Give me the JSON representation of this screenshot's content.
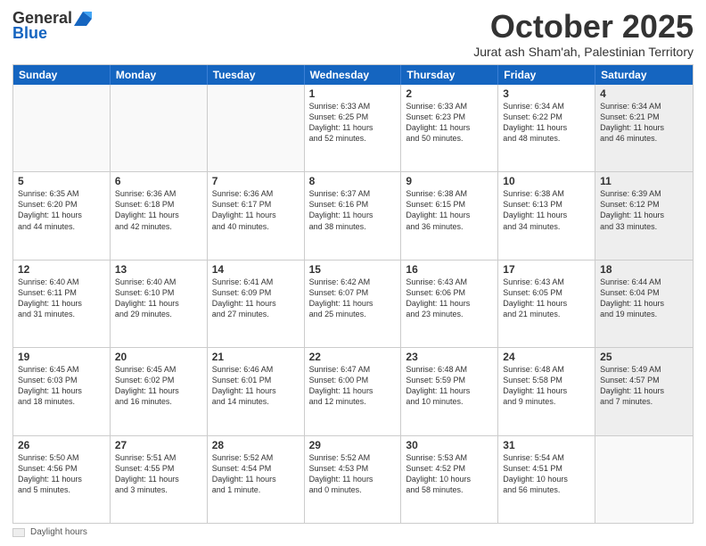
{
  "logo": {
    "general": "General",
    "blue": "Blue"
  },
  "title": "October 2025",
  "subtitle": "Jurat ash Sham'ah, Palestinian Territory",
  "days": [
    "Sunday",
    "Monday",
    "Tuesday",
    "Wednesday",
    "Thursday",
    "Friday",
    "Saturday"
  ],
  "weeks": [
    [
      {
        "day": "",
        "info": "",
        "shaded": false,
        "empty": true
      },
      {
        "day": "",
        "info": "",
        "shaded": false,
        "empty": true
      },
      {
        "day": "",
        "info": "",
        "shaded": false,
        "empty": true
      },
      {
        "day": "1",
        "info": "Sunrise: 6:33 AM\nSunset: 6:25 PM\nDaylight: 11 hours\nand 52 minutes.",
        "shaded": false,
        "empty": false
      },
      {
        "day": "2",
        "info": "Sunrise: 6:33 AM\nSunset: 6:23 PM\nDaylight: 11 hours\nand 50 minutes.",
        "shaded": false,
        "empty": false
      },
      {
        "day": "3",
        "info": "Sunrise: 6:34 AM\nSunset: 6:22 PM\nDaylight: 11 hours\nand 48 minutes.",
        "shaded": false,
        "empty": false
      },
      {
        "day": "4",
        "info": "Sunrise: 6:34 AM\nSunset: 6:21 PM\nDaylight: 11 hours\nand 46 minutes.",
        "shaded": true,
        "empty": false
      }
    ],
    [
      {
        "day": "5",
        "info": "Sunrise: 6:35 AM\nSunset: 6:20 PM\nDaylight: 11 hours\nand 44 minutes.",
        "shaded": false,
        "empty": false
      },
      {
        "day": "6",
        "info": "Sunrise: 6:36 AM\nSunset: 6:18 PM\nDaylight: 11 hours\nand 42 minutes.",
        "shaded": false,
        "empty": false
      },
      {
        "day": "7",
        "info": "Sunrise: 6:36 AM\nSunset: 6:17 PM\nDaylight: 11 hours\nand 40 minutes.",
        "shaded": false,
        "empty": false
      },
      {
        "day": "8",
        "info": "Sunrise: 6:37 AM\nSunset: 6:16 PM\nDaylight: 11 hours\nand 38 minutes.",
        "shaded": false,
        "empty": false
      },
      {
        "day": "9",
        "info": "Sunrise: 6:38 AM\nSunset: 6:15 PM\nDaylight: 11 hours\nand 36 minutes.",
        "shaded": false,
        "empty": false
      },
      {
        "day": "10",
        "info": "Sunrise: 6:38 AM\nSunset: 6:13 PM\nDaylight: 11 hours\nand 34 minutes.",
        "shaded": false,
        "empty": false
      },
      {
        "day": "11",
        "info": "Sunrise: 6:39 AM\nSunset: 6:12 PM\nDaylight: 11 hours\nand 33 minutes.",
        "shaded": true,
        "empty": false
      }
    ],
    [
      {
        "day": "12",
        "info": "Sunrise: 6:40 AM\nSunset: 6:11 PM\nDaylight: 11 hours\nand 31 minutes.",
        "shaded": false,
        "empty": false
      },
      {
        "day": "13",
        "info": "Sunrise: 6:40 AM\nSunset: 6:10 PM\nDaylight: 11 hours\nand 29 minutes.",
        "shaded": false,
        "empty": false
      },
      {
        "day": "14",
        "info": "Sunrise: 6:41 AM\nSunset: 6:09 PM\nDaylight: 11 hours\nand 27 minutes.",
        "shaded": false,
        "empty": false
      },
      {
        "day": "15",
        "info": "Sunrise: 6:42 AM\nSunset: 6:07 PM\nDaylight: 11 hours\nand 25 minutes.",
        "shaded": false,
        "empty": false
      },
      {
        "day": "16",
        "info": "Sunrise: 6:43 AM\nSunset: 6:06 PM\nDaylight: 11 hours\nand 23 minutes.",
        "shaded": false,
        "empty": false
      },
      {
        "day": "17",
        "info": "Sunrise: 6:43 AM\nSunset: 6:05 PM\nDaylight: 11 hours\nand 21 minutes.",
        "shaded": false,
        "empty": false
      },
      {
        "day": "18",
        "info": "Sunrise: 6:44 AM\nSunset: 6:04 PM\nDaylight: 11 hours\nand 19 minutes.",
        "shaded": true,
        "empty": false
      }
    ],
    [
      {
        "day": "19",
        "info": "Sunrise: 6:45 AM\nSunset: 6:03 PM\nDaylight: 11 hours\nand 18 minutes.",
        "shaded": false,
        "empty": false
      },
      {
        "day": "20",
        "info": "Sunrise: 6:45 AM\nSunset: 6:02 PM\nDaylight: 11 hours\nand 16 minutes.",
        "shaded": false,
        "empty": false
      },
      {
        "day": "21",
        "info": "Sunrise: 6:46 AM\nSunset: 6:01 PM\nDaylight: 11 hours\nand 14 minutes.",
        "shaded": false,
        "empty": false
      },
      {
        "day": "22",
        "info": "Sunrise: 6:47 AM\nSunset: 6:00 PM\nDaylight: 11 hours\nand 12 minutes.",
        "shaded": false,
        "empty": false
      },
      {
        "day": "23",
        "info": "Sunrise: 6:48 AM\nSunset: 5:59 PM\nDaylight: 11 hours\nand 10 minutes.",
        "shaded": false,
        "empty": false
      },
      {
        "day": "24",
        "info": "Sunrise: 6:48 AM\nSunset: 5:58 PM\nDaylight: 11 hours\nand 9 minutes.",
        "shaded": false,
        "empty": false
      },
      {
        "day": "25",
        "info": "Sunrise: 5:49 AM\nSunset: 4:57 PM\nDaylight: 11 hours\nand 7 minutes.",
        "shaded": true,
        "empty": false
      }
    ],
    [
      {
        "day": "26",
        "info": "Sunrise: 5:50 AM\nSunset: 4:56 PM\nDaylight: 11 hours\nand 5 minutes.",
        "shaded": false,
        "empty": false
      },
      {
        "day": "27",
        "info": "Sunrise: 5:51 AM\nSunset: 4:55 PM\nDaylight: 11 hours\nand 3 minutes.",
        "shaded": false,
        "empty": false
      },
      {
        "day": "28",
        "info": "Sunrise: 5:52 AM\nSunset: 4:54 PM\nDaylight: 11 hours\nand 1 minute.",
        "shaded": false,
        "empty": false
      },
      {
        "day": "29",
        "info": "Sunrise: 5:52 AM\nSunset: 4:53 PM\nDaylight: 11 hours\nand 0 minutes.",
        "shaded": false,
        "empty": false
      },
      {
        "day": "30",
        "info": "Sunrise: 5:53 AM\nSunset: 4:52 PM\nDaylight: 10 hours\nand 58 minutes.",
        "shaded": false,
        "empty": false
      },
      {
        "day": "31",
        "info": "Sunrise: 5:54 AM\nSunset: 4:51 PM\nDaylight: 10 hours\nand 56 minutes.",
        "shaded": false,
        "empty": false
      },
      {
        "day": "",
        "info": "",
        "shaded": true,
        "empty": true
      }
    ]
  ],
  "footer": {
    "box_label": "Daylight hours"
  }
}
